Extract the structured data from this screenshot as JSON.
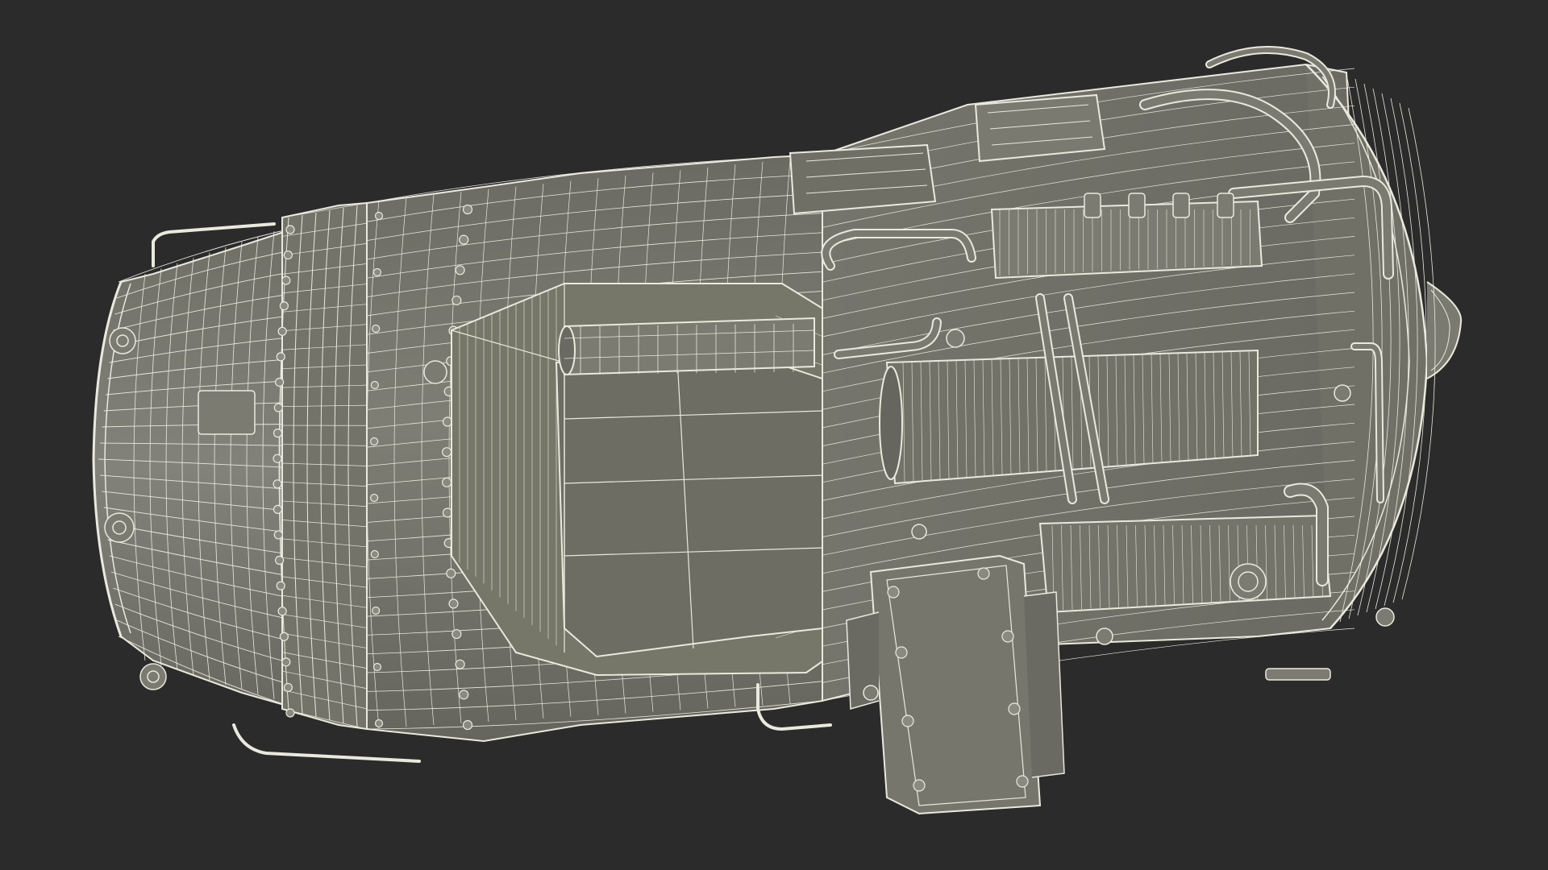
{
  "scene": {
    "subject": "wireframe-render",
    "colors": {
      "background": "#2b2b2b",
      "body": "#77776d",
      "body_dark": "#5e5e56",
      "body_light": "#8a8a80",
      "wire": "#e9e9dd",
      "shadow": "#3d3d38"
    }
  }
}
